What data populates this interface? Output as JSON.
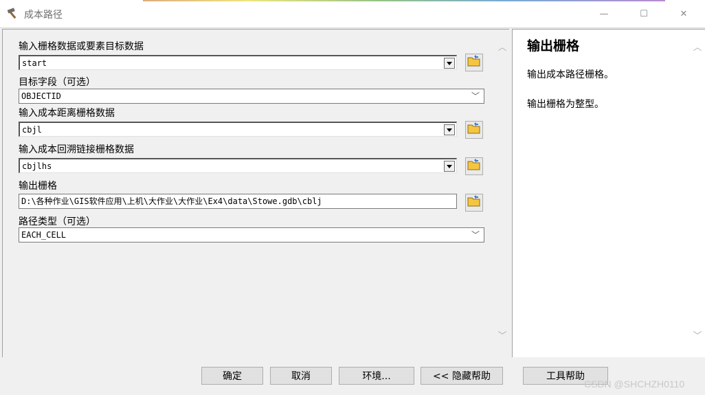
{
  "window": {
    "title": "成本路径",
    "minimize_glyph": "—",
    "maximize_glyph": "☐",
    "close_glyph": "✕"
  },
  "form": {
    "fields": [
      {
        "label": "输入栅格数据或要素目标数据",
        "value": "start"
      },
      {
        "label": "目标字段（可选）",
        "value": "OBJECTID"
      },
      {
        "label": "输入成本距离栅格数据",
        "value": "cbjl"
      },
      {
        "label": "输入成本回溯链接栅格数据",
        "value": "cbjlhs"
      },
      {
        "label": "输出栅格",
        "value": "D:\\各种作业\\GIS软件应用\\上机\\大作业\\大作业\\Ex4\\data\\Stowe.gdb\\cblj"
      },
      {
        "label": "路径类型（可选）",
        "value": "EACH_CELL"
      }
    ]
  },
  "help": {
    "title": "输出栅格",
    "lines": [
      "输出成本路径栅格。",
      "输出栅格为整型。"
    ]
  },
  "buttons": {
    "ok": "确定",
    "cancel": "取消",
    "environments": "环境...",
    "hide_help": "<< 隐藏帮助",
    "tool_help": "工具帮助"
  },
  "watermark": "CSDN @SHCHZH0110",
  "icons": {
    "title_icon": "hammer-icon",
    "browse_icon": "folder-icon",
    "scroll_up": "chevron-up-icon",
    "scroll_down": "chevron-down-icon"
  },
  "colors": {
    "window_bg": "#f0f0f0",
    "help_bg": "#ffffff",
    "folder_yellow": "#f5c542"
  }
}
